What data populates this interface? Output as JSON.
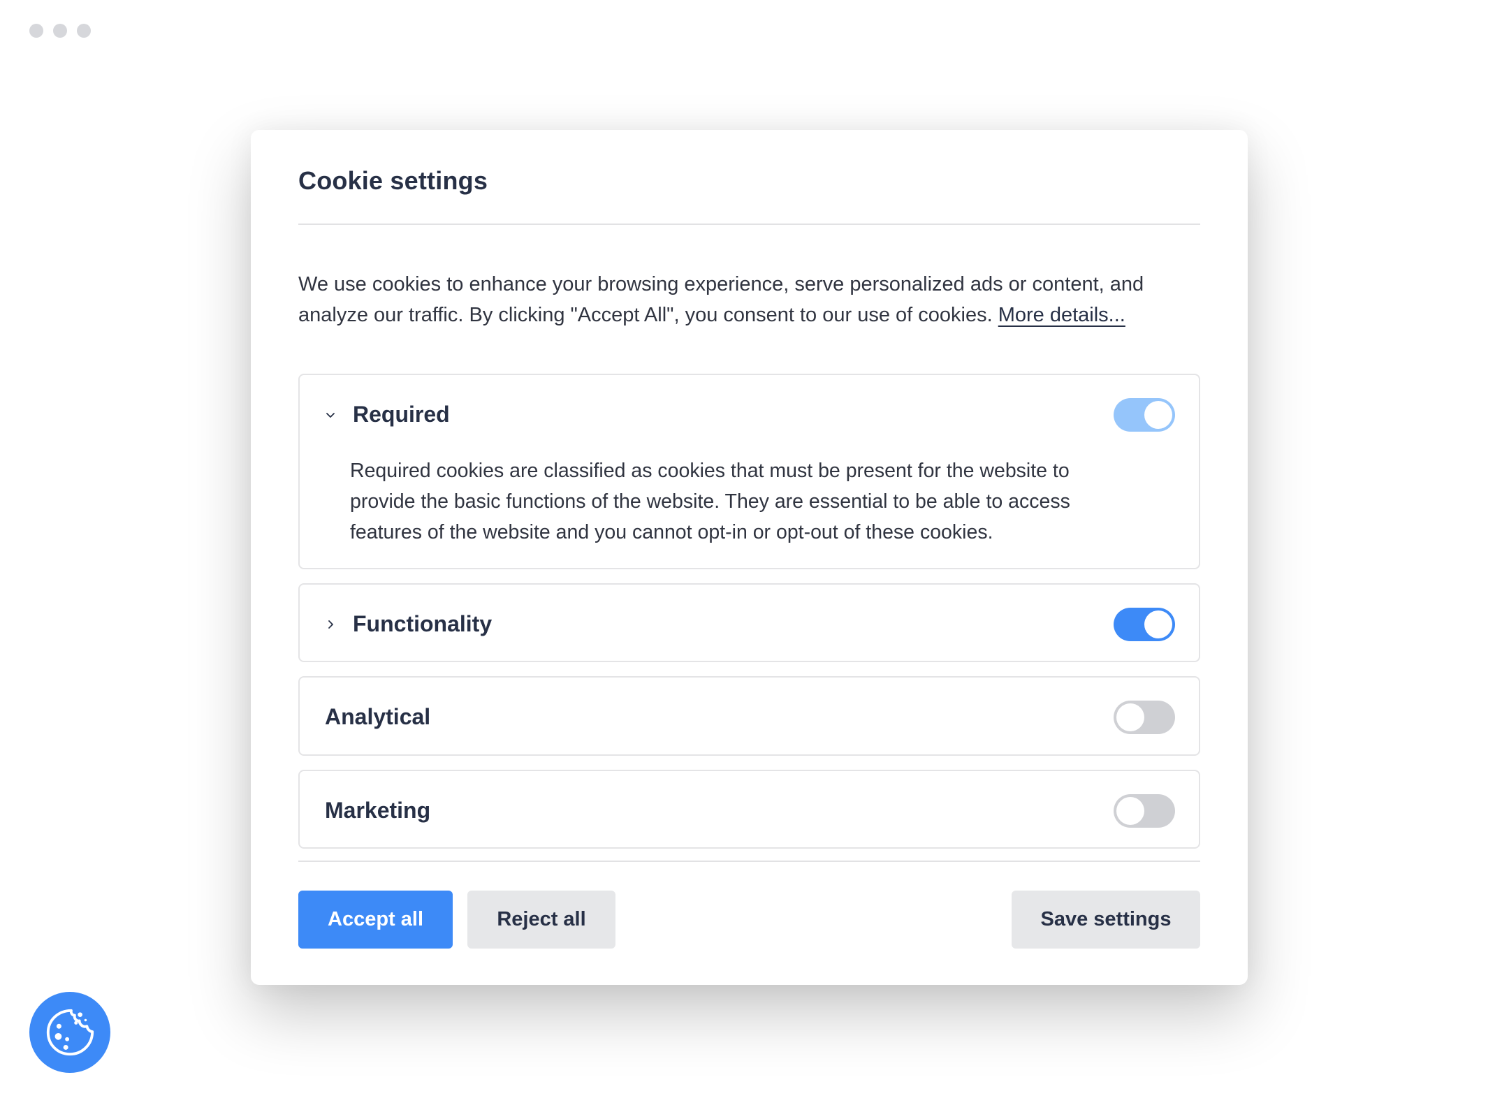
{
  "window": {
    "controls": [
      "dot",
      "dot",
      "dot"
    ]
  },
  "dialog": {
    "title": "Cookie settings",
    "description": "We use cookies to enhance your browsing experience, serve personalized ads or content, and analyze our traffic. By clicking \"Accept All\", you consent to our use of cookies. ",
    "more_details_link": "More details..."
  },
  "categories": [
    {
      "label": "Required",
      "expandable": true,
      "expanded": true,
      "chevron_icon": "chevron-down-icon",
      "enabled": true,
      "disabled": true,
      "description": "Required cookies are classified as cookies that must be present for the website to provide the basic functions of the website. They are essential to be able to access features of the website and you cannot opt-in or opt-out of these cookies."
    },
    {
      "label": "Functionality",
      "expandable": true,
      "expanded": false,
      "chevron_icon": "chevron-right-icon",
      "enabled": true,
      "disabled": false
    },
    {
      "label": "Analytical",
      "expandable": false,
      "enabled": false,
      "disabled": false
    },
    {
      "label": "Marketing",
      "expandable": false,
      "enabled": false,
      "disabled": false
    }
  ],
  "buttons": {
    "accept_all": "Accept all",
    "reject_all": "Reject all",
    "save_settings": "Save settings"
  },
  "fab": {
    "icon": "cookie-icon"
  },
  "colors": {
    "accent": "#3d8af7",
    "accent_disabled": "#95c5fb",
    "toggle_off": "#cfd0d4",
    "text": "#273046",
    "secondary_button": "#e6e7e9"
  }
}
